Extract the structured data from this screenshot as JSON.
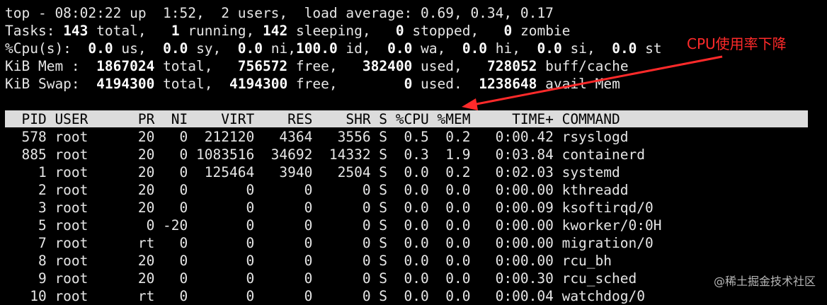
{
  "summary": {
    "line1": "top - 08:02:22 up  1:52,  2 users,  load average: 0.69, 0.34, 0.17",
    "tasks": {
      "prefix": "Tasks: ",
      "total": "143",
      "total_label": " total,   ",
      "running": "1",
      "running_label": " running, ",
      "sleeping": "142",
      "sleeping_label": " sleeping,   ",
      "stopped": "0",
      "stopped_label": " stopped,   ",
      "zombie": "0",
      "zombie_label": " zombie"
    },
    "cpu": {
      "prefix": "%Cpu(s):  ",
      "us": "0.0",
      "us_label": " us,  ",
      "sy": "0.0",
      "sy_label": " sy,  ",
      "ni": "0.0",
      "ni_label": " ni,",
      "id": "100.0",
      "id_label": " id,  ",
      "wa": "0.0",
      "wa_label": " wa,  ",
      "hi": "0.0",
      "hi_label": " hi,  ",
      "si": "0.0",
      "si_label": " si,  ",
      "st": "0.0",
      "st_label": " st"
    },
    "mem": {
      "prefix": "KiB Mem :  ",
      "total": "1867024",
      "total_label": " total,   ",
      "free": "756572",
      "free_label": " free,   ",
      "used": "382400",
      "used_label": " used,   ",
      "cache": "728052",
      "cache_label": " buff/cache"
    },
    "swap": {
      "prefix": "KiB Swap:  ",
      "total": "4194300",
      "total_label": " total,  ",
      "free": "4194300",
      "free_label": " free,        ",
      "used": "0",
      "used_label": " used.  ",
      "avail": "1238648",
      "avail_label": " avail Mem"
    }
  },
  "table": {
    "header": "  PID USER      PR  NI    VIRT    RES    SHR S %CPU %MEM     TIME+ COMMAND",
    "rows": [
      "  578 root      20   0  212120   4364   3556 S  0.5  0.2   0:00.42 rsyslogd",
      "  885 root      20   0 1083516  34692  14332 S  0.3  1.9   0:03.84 containerd",
      "    1 root      20   0  125464   3940   2504 S  0.0  0.2   0:02.03 systemd",
      "    2 root      20   0       0      0      0 S  0.0  0.0   0:00.00 kthreadd",
      "    3 root      20   0       0      0      0 S  0.0  0.0   0:00.09 ksoftirqd/0",
      "    5 root       0 -20       0      0      0 S  0.0  0.0   0:00.00 kworker/0:0H",
      "    7 root      rt   0       0      0      0 S  0.0  0.0   0:00.00 migration/0",
      "    8 root      20   0       0      0      0 S  0.0  0.0   0:00.00 rcu_bh",
      "    9 root      20   0       0      0      0 S  0.0  0.0   0:00.30 rcu_sched",
      "   10 root      rt   0       0      0      0 S  0.0  0.0   0:00.04 watchdog/0"
    ]
  },
  "annotation": {
    "text": "CPU使用率下降",
    "color": "#ff2a2a"
  },
  "watermark": "@稀土掘金技术社区",
  "colors": {
    "background": "#000000",
    "text": "#e6e6e6",
    "header_bar": "#dcdcdc"
  }
}
